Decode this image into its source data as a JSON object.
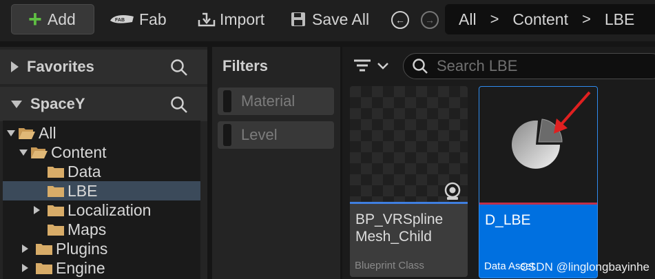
{
  "toolbar": {
    "add_label": "Add",
    "fab_label": "Fab",
    "import_label": "Import",
    "save_all_label": "Save All"
  },
  "breadcrumb": [
    "All",
    "Content",
    "LBE"
  ],
  "sources": {
    "favorites_label": "Favorites",
    "project_label": "SpaceY"
  },
  "tree": [
    {
      "label": "All"
    },
    {
      "label": "Content"
    },
    {
      "label": "Data"
    },
    {
      "label": "LBE"
    },
    {
      "label": "Localization"
    },
    {
      "label": "Maps"
    },
    {
      "label": "Plugins"
    },
    {
      "label": "Engine"
    }
  ],
  "filters": {
    "title": "Filters",
    "items": [
      "Material",
      "Level"
    ]
  },
  "search": {
    "placeholder": "Search LBE"
  },
  "assets": [
    {
      "name_line1": "BP_VRSpline",
      "name_line2": "Mesh_Child",
      "type": "Blueprint Class"
    },
    {
      "name_line1": "D_LBE",
      "name_line2": "",
      "type": "Data Asset"
    }
  ],
  "watermark": "CSDN @linglongbayinhe",
  "colors": {
    "accent_green": "#5fbf43",
    "selection_blue": "#0070e0",
    "blueprint_bar": "#3f7fe0",
    "data_asset_bar": "#c0304a",
    "arrow_red": "#e02020"
  }
}
